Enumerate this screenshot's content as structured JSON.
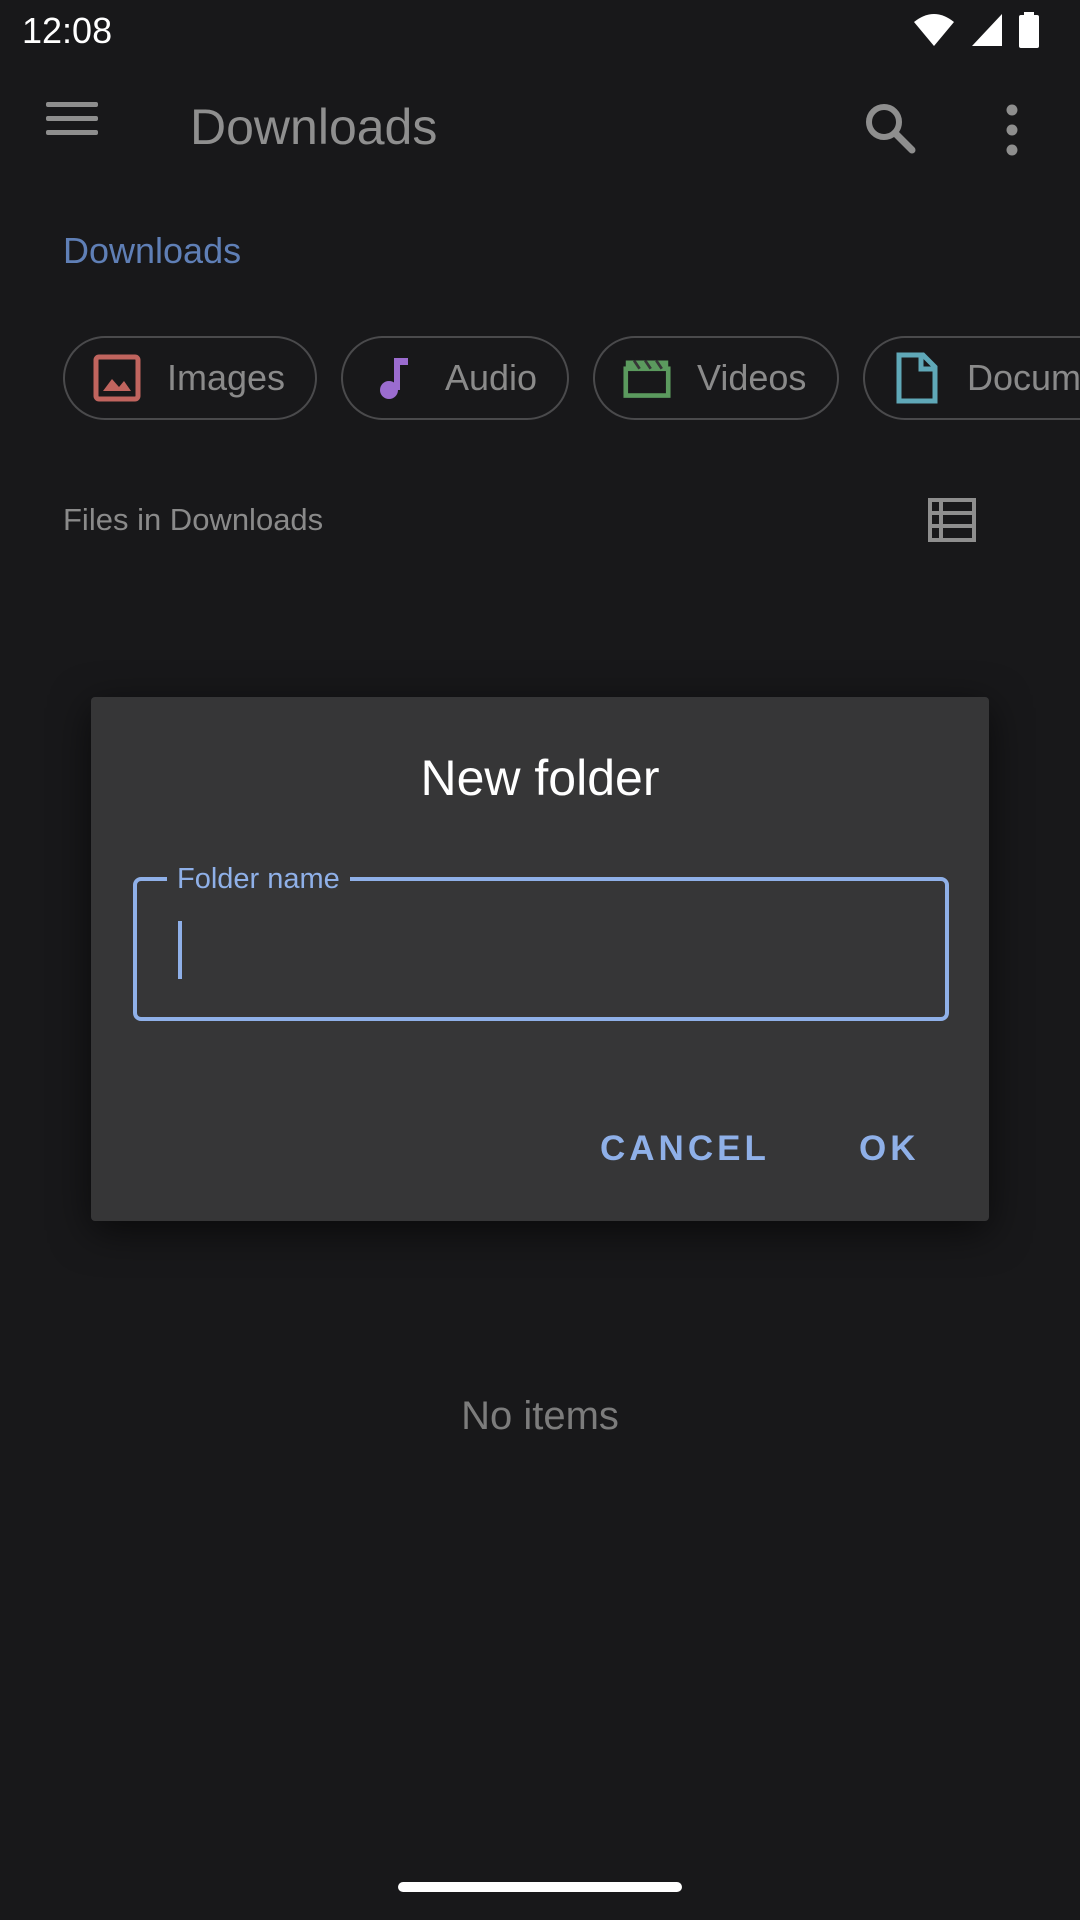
{
  "status_bar": {
    "time": "12:08"
  },
  "app_bar": {
    "title": "Downloads"
  },
  "breadcrumb": {
    "current": "Downloads"
  },
  "chips": [
    {
      "label": "Images",
      "icon": "image-icon",
      "color": "#c0645e"
    },
    {
      "label": "Audio",
      "icon": "music-note-icon",
      "color": "#9b6ccf"
    },
    {
      "label": "Videos",
      "icon": "clapperboard-icon",
      "color": "#5b9a5e"
    },
    {
      "label": "Docum",
      "icon": "document-icon",
      "color": "#5fa8b8"
    }
  ],
  "section": {
    "title": "Files in Downloads"
  },
  "empty_state": {
    "text": "No items"
  },
  "dialog": {
    "title": "New folder",
    "field_label": "Folder name",
    "field_value": "",
    "cancel_label": "CANCEL",
    "ok_label": "OK"
  },
  "colors": {
    "background": "#18181a",
    "dialog_background": "#363637",
    "accent": "#8fb0e8",
    "breadcrumb": "#5f7fb6"
  }
}
